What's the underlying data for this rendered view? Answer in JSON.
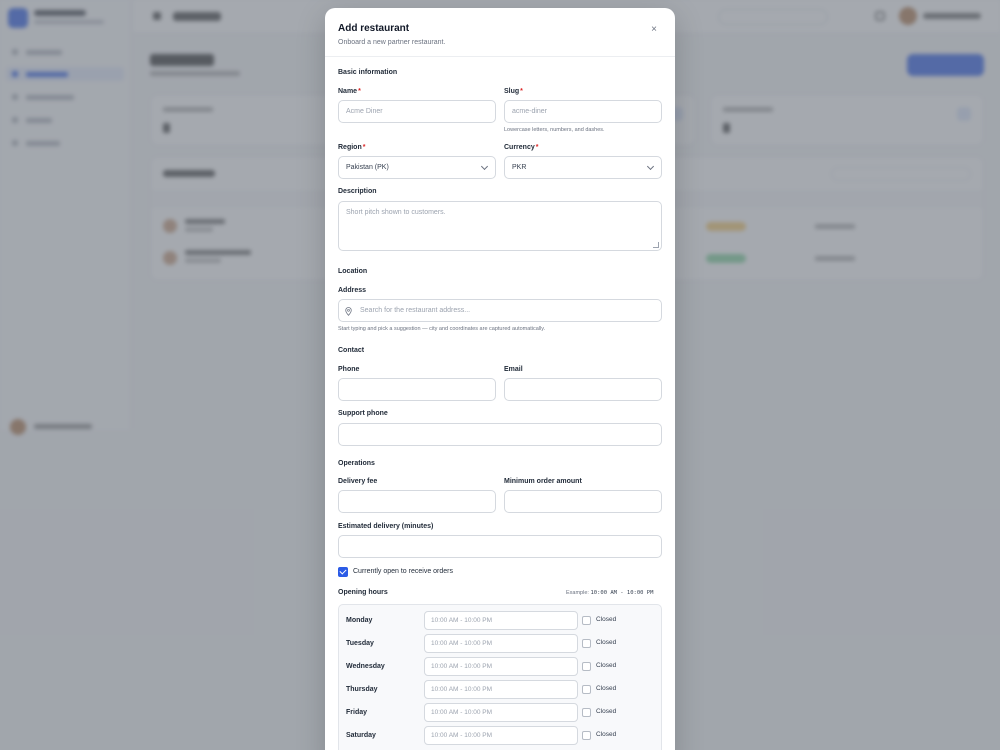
{
  "modal": {
    "title": "Add restaurant",
    "subtitle": "Onboard a new partner restaurant.",
    "close_glyph": "×"
  },
  "basic": {
    "section": "Basic information",
    "name_label": "Name",
    "name_placeholder": "Acme Diner",
    "slug_label": "Slug",
    "slug_placeholder": "acme-diner",
    "slug_hint": "Lowercase letters, numbers, and dashes.",
    "region_label": "Region",
    "region_value": "Pakistan (PK)",
    "currency_label": "Currency",
    "currency_value": "PKR",
    "description_label": "Description",
    "description_placeholder": "Short pitch shown to customers.",
    "required_mark": "*"
  },
  "location": {
    "section": "Location",
    "address_label": "Address",
    "address_placeholder": "Search for the restaurant address...",
    "address_hint": "Start typing and pick a suggestion — city and coordinates are captured automatically."
  },
  "contact": {
    "section": "Contact",
    "phone_label": "Phone",
    "email_label": "Email",
    "support_label": "Support phone"
  },
  "operations": {
    "section": "Operations",
    "delivery_fee_label": "Delivery fee",
    "min_order_label": "Minimum order amount",
    "est_delivery_label": "Estimated delivery (minutes)",
    "open_label": "Currently open to receive orders",
    "open_checked": true
  },
  "hours": {
    "title": "Opening hours",
    "example_prefix": "Example: ",
    "example_value": "10:00 AM - 10:00 PM",
    "closed_label": "Closed",
    "days": [
      {
        "name": "Monday",
        "placeholder": "10:00 AM - 10:00 PM"
      },
      {
        "name": "Tuesday",
        "placeholder": "10:00 AM - 10:00 PM"
      },
      {
        "name": "Wednesday",
        "placeholder": "10:00 AM - 10:00 PM"
      },
      {
        "name": "Thursday",
        "placeholder": "10:00 AM - 10:00 PM"
      },
      {
        "name": "Friday",
        "placeholder": "10:00 AM - 10:00 PM"
      },
      {
        "name": "Saturday",
        "placeholder": "10:00 AM - 10:00 PM"
      }
    ]
  },
  "colors": {
    "accent": "#2b5be6",
    "required": "#dc2626",
    "overlay": "rgba(110,116,126,0.62)"
  }
}
